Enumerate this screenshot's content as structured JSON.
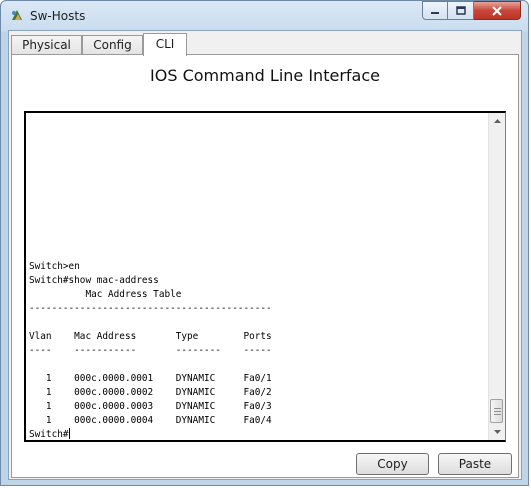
{
  "window": {
    "title": "Sw-Hosts",
    "icon": "packet-tracer-icon",
    "controls": [
      "minimize",
      "maximize",
      "close"
    ]
  },
  "tabs": [
    {
      "label": "Physical",
      "active": false
    },
    {
      "label": "Config",
      "active": false
    },
    {
      "label": "CLI",
      "active": true
    }
  ],
  "cli": {
    "heading": "IOS Command Line Interface",
    "lines": [
      "Switch>en",
      "Switch#show mac-address",
      "          Mac Address Table",
      "-------------------------------------------",
      "",
      "Vlan    Mac Address       Type        Ports",
      "----    -----------       --------    -----",
      "",
      "   1    000c.0000.0001    DYNAMIC     Fa0/1",
      "   1    000c.0000.0002    DYNAMIC     Fa0/2",
      "   1    000c.0000.0003    DYNAMIC     Fa0/3",
      "   1    000c.0000.0004    DYNAMIC     Fa0/4"
    ],
    "prompt": "Switch#"
  },
  "buttons": {
    "copy": "Copy",
    "paste": "Paste"
  },
  "colors": {
    "close_button": "#c9473a",
    "window_frame": "#bfd3e9"
  }
}
